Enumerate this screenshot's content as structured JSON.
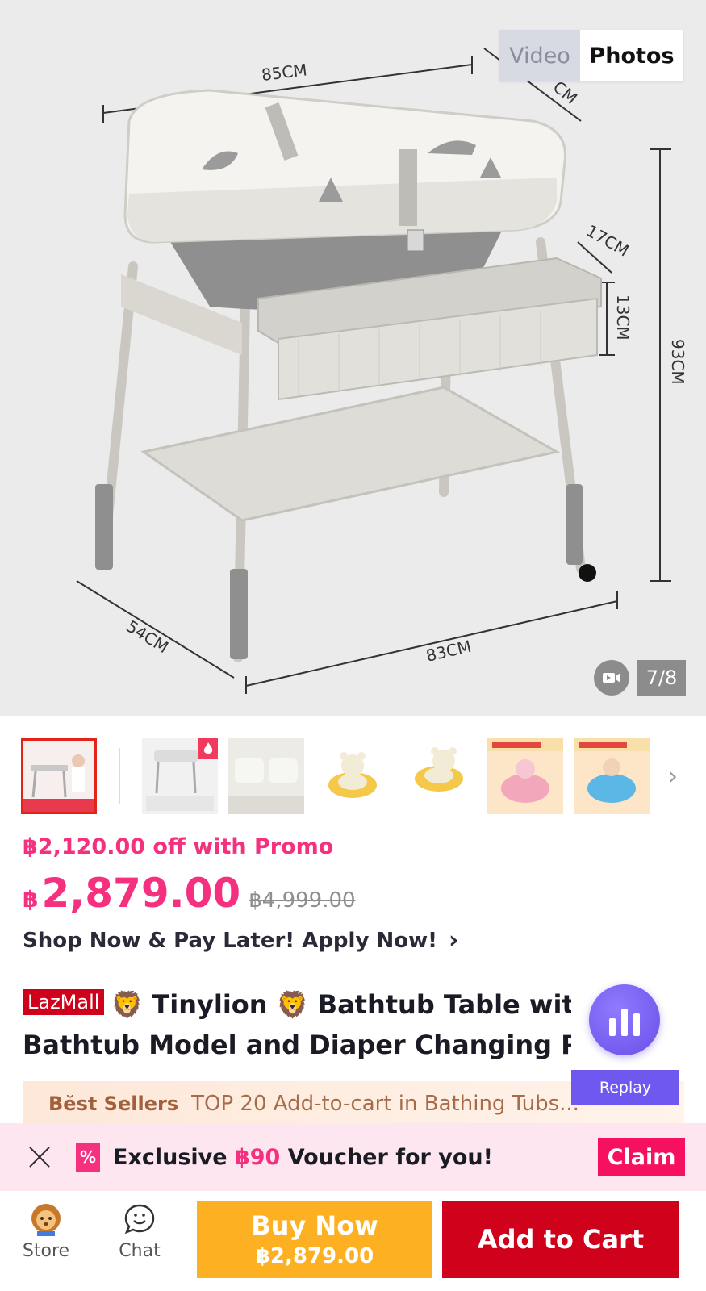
{
  "hero": {
    "dimensions": {
      "width_top": "85CM",
      "depth_top": "CM",
      "side_17": "17CM",
      "side_13": "13CM",
      "height": "93CM",
      "depth_bottom": "54CM",
      "width_bottom": "83CM"
    },
    "media_tabs": {
      "video": "Video",
      "photos": "Photos",
      "selected": "Photos"
    },
    "counter": "7/8",
    "video_icon": "video-camera-icon"
  },
  "thumbnails": {
    "count": 7,
    "active_index": 0,
    "hot_badge_icon": "flame-icon",
    "next_icon": "chevron-right-icon"
  },
  "price": {
    "promo_text": "฿2,120.00 off with Promo",
    "currency": "฿",
    "current": "2,879.00",
    "original": "฿4,999.00"
  },
  "paylater": {
    "text": "Shop Now & Pay Later! Apply Now!",
    "icon": "chevron-right-icon"
  },
  "title": {
    "badge": "LazMall",
    "line1": "🦁 Tinylion 🦁   Bathtub Table with",
    "line2": "Bathtub Model and Diaper Changing Pad I"
  },
  "live": {
    "replay_label": "Replay",
    "icon": "live-bars-icon"
  },
  "bestsellers": {
    "tag": "Bĕst Sellers",
    "text": "TOP 20 Add-to-cart in Bathing Tubs..."
  },
  "voucher": {
    "prefix": "Exclusive ",
    "amount": "฿90",
    "suffix": " Voucher for you!",
    "claim_label": "Claim",
    "icon_glyph": "%"
  },
  "bottombar": {
    "store_label": "Store",
    "chat_label": "Chat",
    "buy_now_label": "Buy Now",
    "buy_now_price": "฿2,879.00",
    "add_to_cart_label": "Add to Cart"
  },
  "colors": {
    "accent_pink": "#f5317f",
    "lazmall_red": "#d0011b",
    "buy_now_orange": "#fdb022",
    "live_purple": "#6a4ee8"
  }
}
